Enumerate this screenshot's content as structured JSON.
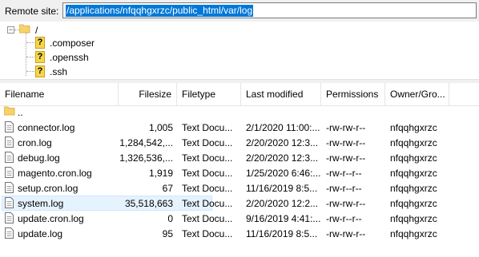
{
  "site_bar": {
    "label": "Remote site:",
    "path": "/applications/nfqqhgxrzc/public_html/var/log"
  },
  "tree": {
    "root": "/",
    "items": [
      ".composer",
      ".openssh",
      ".ssh"
    ]
  },
  "list": {
    "columns": [
      "Filename",
      "Filesize",
      "Filetype",
      "Last modified",
      "Permissions",
      "Owner/Gro..."
    ],
    "parent": "..",
    "rows": [
      {
        "name": "connector.log",
        "size": "1,005",
        "type": "Text Docu...",
        "modified": "2/1/2020 11:00:...",
        "perms": "-rw-rw-r--",
        "owner": "nfqqhgxrzc"
      },
      {
        "name": "cron.log",
        "size": "1,284,542,...",
        "type": "Text Docu...",
        "modified": "2/20/2020 12:3...",
        "perms": "-rw-rw-r--",
        "owner": "nfqqhgxrzc"
      },
      {
        "name": "debug.log",
        "size": "1,326,536,...",
        "type": "Text Docu...",
        "modified": "2/20/2020 12:3...",
        "perms": "-rw-rw-r--",
        "owner": "nfqqhgxrzc"
      },
      {
        "name": "magento.cron.log",
        "size": "1,919",
        "type": "Text Docu...",
        "modified": "1/25/2020 6:46:...",
        "perms": "-rw-r--r--",
        "owner": "nfqqhgxrzc"
      },
      {
        "name": "setup.cron.log",
        "size": "67",
        "type": "Text Docu...",
        "modified": "11/16/2019 8:5...",
        "perms": "-rw-r--r--",
        "owner": "nfqqhgxrzc"
      },
      {
        "name": "system.log",
        "size": "35,518,663",
        "type": "Text Docu...",
        "modified": "2/20/2020 12:2...",
        "perms": "-rw-rw-r--",
        "owner": "nfqqhgxrzc"
      },
      {
        "name": "update.cron.log",
        "size": "0",
        "type": "Text Docu...",
        "modified": "9/16/2019 4:41:...",
        "perms": "-rw-r--r--",
        "owner": "nfqqhgxrzc"
      },
      {
        "name": "update.log",
        "size": "95",
        "type": "Text Docu...",
        "modified": "11/16/2019 8:5...",
        "perms": "-rw-rw-r--",
        "owner": "nfqqhgxrzc"
      }
    ],
    "selected_index": 5
  },
  "icons": {
    "folder": "folder-icon",
    "unknown_folder": "question-folder-icon",
    "file": "text-file-icon"
  },
  "colors": {
    "selection_highlight": "#0078d7",
    "row_selected": "#e5f3ff",
    "folder_yellow": "#f5d54a"
  }
}
